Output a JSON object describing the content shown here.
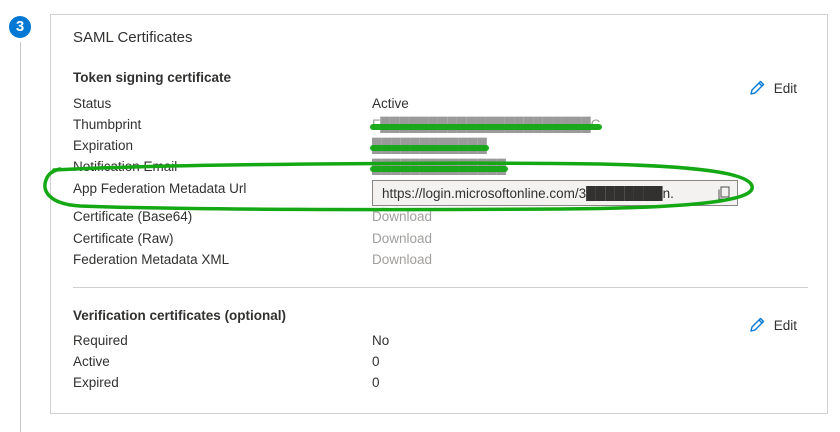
{
  "step": {
    "number": "3"
  },
  "card": {
    "title": "SAML Certificates"
  },
  "token_signing": {
    "title": "Token signing certificate",
    "edit_label": "Edit",
    "rows": [
      {
        "label": "Status",
        "value": "Active"
      },
      {
        "label": "Thumbprint",
        "value": "F██████████████████████C"
      },
      {
        "label": "Expiration",
        "value": "████████████"
      },
      {
        "label": "Notification Email",
        "value": "██████████████"
      },
      {
        "label": "App Federation Metadata Url",
        "value": "https://login.microsoftonline.com/3████████n."
      },
      {
        "label": "Certificate (Base64)",
        "value": "Download"
      },
      {
        "label": "Certificate (Raw)",
        "value": "Download"
      },
      {
        "label": "Federation Metadata XML",
        "value": "Download"
      }
    ]
  },
  "verification": {
    "title": "Verification certificates (optional)",
    "edit_label": "Edit",
    "rows": [
      {
        "label": "Required",
        "value": "No"
      },
      {
        "label": "Active",
        "value": "0"
      },
      {
        "label": "Expired",
        "value": "0"
      }
    ]
  },
  "colors": {
    "accent": "#0078d4",
    "highlight": "#14a814",
    "disabled_text": "#a19f9d"
  },
  "icons": {
    "edit": "pencil-icon",
    "copy": "copy-icon"
  }
}
